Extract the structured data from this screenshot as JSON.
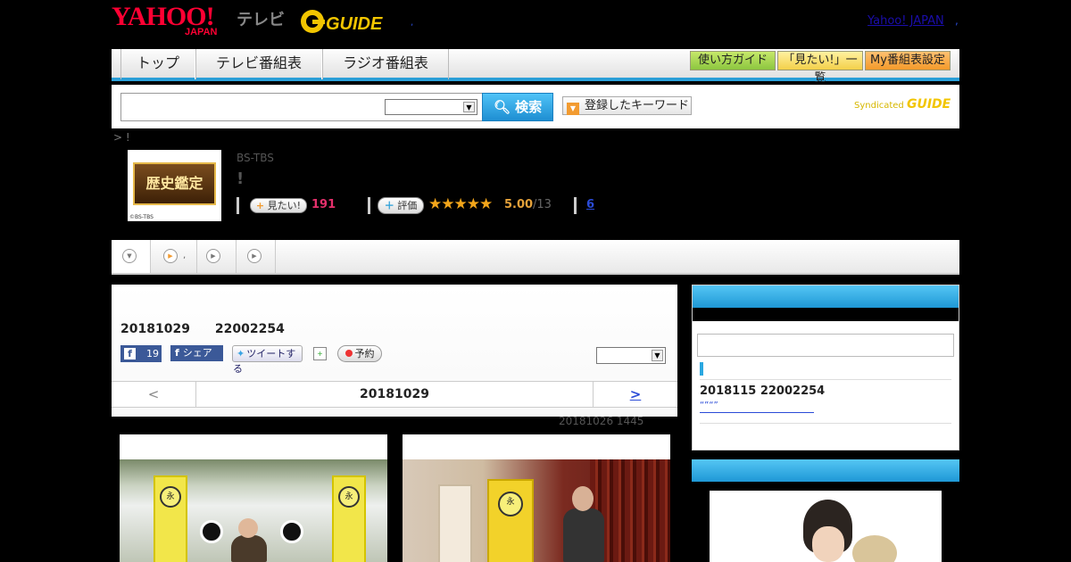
{
  "header": {
    "yahoo_logo": "YAHOO!",
    "yahoo_japan": "JAPAN",
    "tv_label": "テレビ",
    "gguide_logo": "GUIDE",
    "yj_link": "Yahoo! JAPAN",
    "dot1": ",",
    "dot2": ","
  },
  "nav": {
    "tabs": [
      "トップ",
      "テレビ番組表",
      "ラジオ番組表"
    ],
    "guide_button": "使い方ガイド",
    "mitai_list_button": "「見たい!」一覧",
    "my_settings_button": "My番組表設定"
  },
  "search": {
    "button_label": "検索",
    "keyword_button": "登録したキーワード",
    "syndicated": "Syndicated",
    "syndicated_logo": "GUIDE"
  },
  "breadcrumb": "> !",
  "program": {
    "thumb_title": "歴史鑑定",
    "thumb_copyright": "©BS-TBS",
    "channel": "BS-TBS",
    "title": "!",
    "mitai_label": "見たい!",
    "mitai_count": "191",
    "rating_label": "評価",
    "stars": "★★★★★",
    "rating_score": "5.00",
    "rating_count": "/13",
    "review_count": "6"
  },
  "content_tabs": {
    "tab2_suffix": ","
  },
  "episode": {
    "datetime": "20181029　　22002254",
    "fb_like_count": "19",
    "fb_share_label": "シェア",
    "tweet_label": "ツイートする",
    "reserve_label": "予約",
    "pager_prev": "<",
    "pager_date": "20181029",
    "pager_next": ">",
    "updated": "20181026  1445"
  },
  "sidebar": {
    "next_datetime": "2018115  22002254",
    "next_link": "“”“”"
  },
  "colors": {
    "accent": "#2a9fd8",
    "pink": "#e6306c",
    "star": "#f2a51a"
  }
}
